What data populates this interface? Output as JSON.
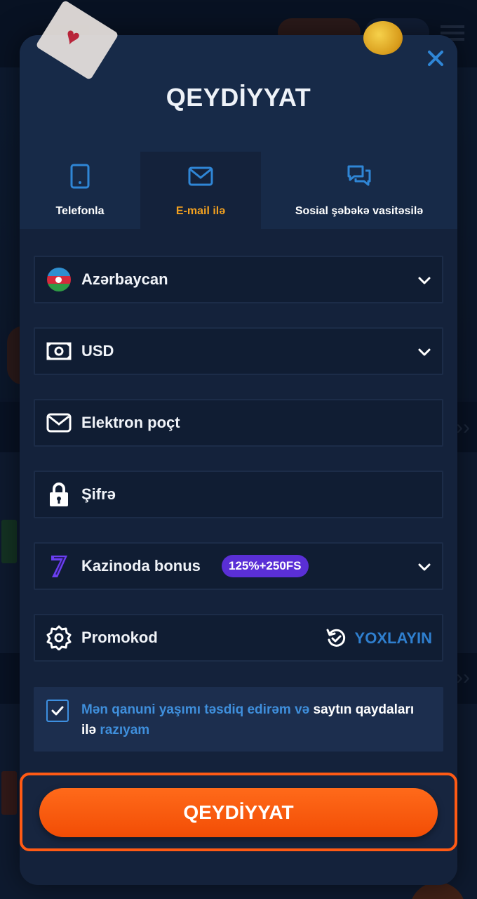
{
  "modal": {
    "title": "QEYDİYYAT",
    "close_icon": "close-icon"
  },
  "tabs": [
    {
      "label": "Telefonla",
      "icon": "phone-icon",
      "active": false
    },
    {
      "label": "E-mail ilə",
      "icon": "envelope-icon",
      "active": true
    },
    {
      "label": "Sosial şəbəkə vasitəsilə",
      "icon": "chat-bubbles-icon",
      "active": false
    }
  ],
  "form": {
    "country": {
      "value": "Azərbaycan",
      "icon": "azerbaijan-flag-icon"
    },
    "currency": {
      "value": "USD",
      "icon": "banknote-icon"
    },
    "email": {
      "placeholder": "Elektron poçt",
      "icon": "envelope-icon"
    },
    "password": {
      "placeholder": "Şifrə",
      "icon": "lock-icon"
    },
    "bonus": {
      "label": "Kazinoda bonus",
      "badge": "125%+250FS",
      "icon": "casino-seven-icon"
    },
    "promo": {
      "placeholder": "Promokod",
      "icon": "gear-badge-icon",
      "check_label": "YOXLAYIN"
    }
  },
  "agreement": {
    "part1": "Mən qanuni yaşımı təsdiq edirəm və",
    "part2": " saytın qaydaları ilə ",
    "part3": "razıyam",
    "checked": true
  },
  "submit": {
    "label": "QEYDİYYAT"
  },
  "colors": {
    "accent_orange": "#ff5a14",
    "active_tab": "#f3a120",
    "link_blue": "#3f8fdc",
    "badge_purple": "#5a2fd6",
    "modal_bg": "#14223b"
  }
}
